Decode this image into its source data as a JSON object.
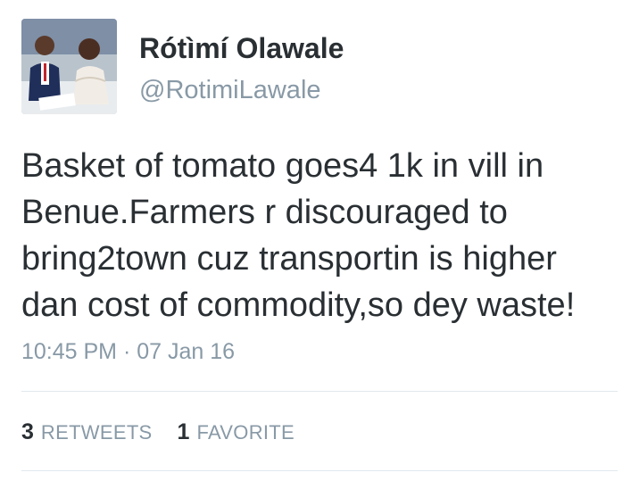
{
  "user": {
    "display_name": "Rótìmí Olawale",
    "handle": "@RotimiLawale"
  },
  "tweet": {
    "text": "Basket of tomato goes4 1k in vill in\nBenue.Farmers r discouraged to\nbring2town cuz transportin is higher\ndan cost of commodity,so dey waste!",
    "timestamp": "10:45 PM · 07 Jan 16"
  },
  "stats": {
    "retweets_count": "3",
    "retweets_label": "RETWEETS",
    "favorites_count": "1",
    "favorites_label": "FAVORITE"
  },
  "colors": {
    "text": "#292f33",
    "secondary": "#8899a6",
    "divider": "#e1e8ed"
  }
}
